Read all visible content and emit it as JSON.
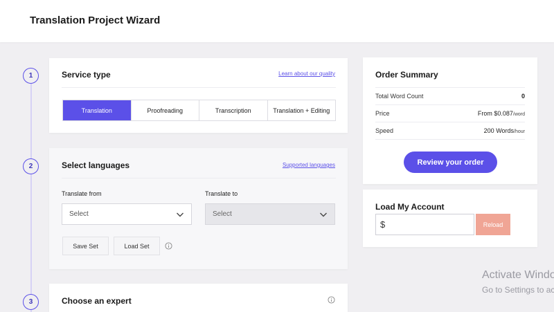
{
  "header": {
    "title": "Translation Project Wizard"
  },
  "steps": [
    "1",
    "2",
    "3"
  ],
  "service": {
    "title": "Service type",
    "link": "Learn about our quality",
    "options": [
      "Translation",
      "Proofreading",
      "Transcription",
      "Translation + Editing"
    ],
    "selected": "Translation"
  },
  "languages": {
    "title": "Select languages",
    "link": "Supported languages",
    "from_label": "Translate from",
    "from_value": "Select",
    "to_label": "Translate to",
    "to_value": "Select",
    "save_set": "Save Set",
    "load_set": "Load Set"
  },
  "expert": {
    "title": "Choose an expert"
  },
  "summary": {
    "title": "Order Summary",
    "rows": [
      {
        "label": "Total Word Count",
        "value": "0"
      },
      {
        "label": "Price",
        "value": "From $0.087",
        "unit": "/word"
      },
      {
        "label": "Speed",
        "value": "200 Words",
        "unit": "/hour"
      }
    ],
    "button": "Review your order"
  },
  "account": {
    "title": "Load My Account",
    "currency": "$",
    "button": "Reload"
  },
  "watermark": {
    "line1": "Activate Windo",
    "line2": "Go to Settings to ac"
  },
  "colors": {
    "accent": "#5b50e8",
    "reload": "#f0a595",
    "count": "#e0524a"
  }
}
